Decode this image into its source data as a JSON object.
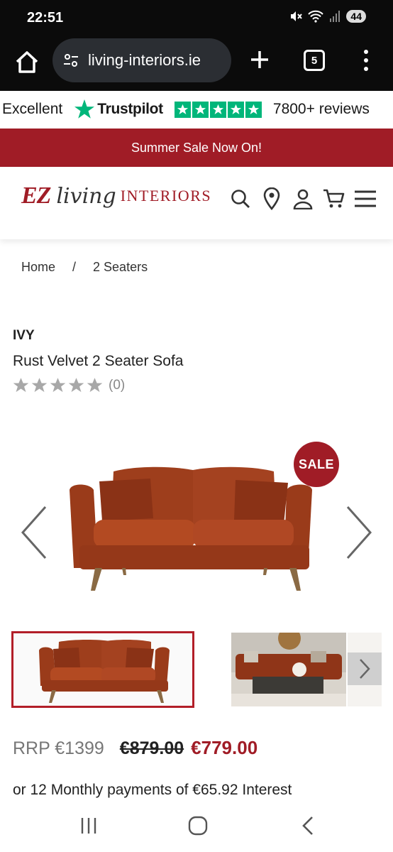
{
  "status_bar": {
    "time": "22:51",
    "battery": "44"
  },
  "browser": {
    "url": "living-interiors.ie",
    "tab_count": "5"
  },
  "trustpilot": {
    "rating_word": "Excellent",
    "brand": "Trustpilot",
    "reviews": "7800+ reviews",
    "stars": 5,
    "color": "#00b67a"
  },
  "banner": {
    "text": "Summer Sale Now On!",
    "color": "#a01c26"
  },
  "header": {
    "logo": {
      "ez": "EZ",
      "living": "living",
      "interiors": "INTERIORS"
    },
    "icons": [
      "search-icon",
      "location-pin-icon",
      "account-icon",
      "cart-icon",
      "hamburger-menu-icon"
    ]
  },
  "breadcrumb": {
    "home": "Home",
    "separator": "/",
    "current": "2 Seaters"
  },
  "product": {
    "brand": "IVY",
    "title": "Rust Velvet 2 Seater Sofa",
    "rating_stars": 5,
    "rating_count": "(0)",
    "badge": "SALE"
  },
  "pricing": {
    "rrp": "RRP €1399",
    "old_price": "€879.00",
    "new_price": "€779.00",
    "monthly": "or 12 Monthly payments of €65.92 Interest"
  }
}
